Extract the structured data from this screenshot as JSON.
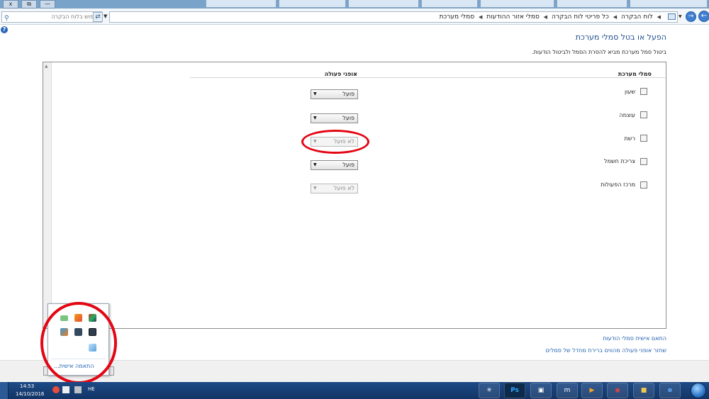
{
  "browser": {
    "tabs": [
      "",
      "",
      "",
      "",
      "",
      "",
      ""
    ],
    "window_buttons": {
      "close": "x",
      "restore": "⧉",
      "minimize": "—"
    }
  },
  "address_bar": {
    "search_placeholder": "חיפוש בלוח הבקרה",
    "breadcrumbs": [
      "לוח הבקרה",
      "כל פריטי לוח הבקרה",
      "סמלי אזור ההודעות",
      "סמלי מערכת"
    ]
  },
  "page": {
    "title": "הפעל או בטל סמלי מערכת",
    "description": "ביטול סמל מערכת מביא להסרת הסמל ולביטול הודעות."
  },
  "table": {
    "headers": {
      "icons": "סמלי מערכת",
      "behavior": "אופני פעולה"
    },
    "rows": [
      {
        "label": "שעון",
        "icon": "clock-icon",
        "value": "פועל",
        "enabled": true
      },
      {
        "label": "עוצמה",
        "icon": "volume-icon",
        "value": "פועל",
        "enabled": true
      },
      {
        "label": "רשת",
        "icon": "network-icon",
        "value": "לא פועל",
        "enabled": false
      },
      {
        "label": "צריכת חשמל",
        "icon": "power-icon",
        "value": "פועל",
        "enabled": true
      },
      {
        "label": "מרכז הפעולות",
        "icon": "action-center-flag-icon",
        "value": "לא פועל",
        "enabled": false
      }
    ]
  },
  "links": {
    "customize_icons": "התאם אישית סמלי הודעות",
    "restore_defaults": "שחזר אופני פעולה מהווים ברירת מחדל של סמלים"
  },
  "tray_popup": {
    "customize": "התאמה אישית..."
  },
  "taskbar": {
    "time": "14:53",
    "date": "14/10/2016",
    "language": "HE",
    "apps": [
      "explorer-wheel-icon",
      "photoshop-icon",
      "network-computers-icon",
      "mail-m-icon",
      "media-player-icon",
      "chrome-icon",
      "folder-icon",
      "internet-explorer-icon"
    ],
    "photoshop_label": "Ps"
  },
  "colors": {
    "link": "#1f5fb0",
    "title": "#1f4e8f",
    "annotation": "#e30613",
    "taskbar": "#1d4a86"
  }
}
